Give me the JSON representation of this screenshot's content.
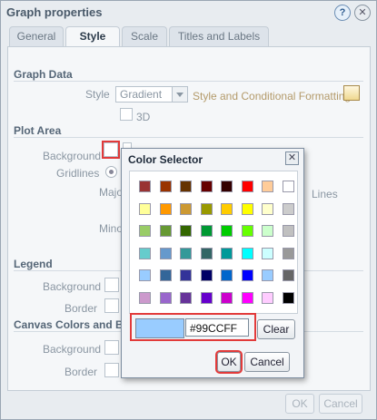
{
  "dialog": {
    "title": "Graph properties",
    "help_icon": "help-icon",
    "close_icon": "close-icon",
    "tabs": [
      {
        "label": "General",
        "active": false
      },
      {
        "label": "Style",
        "active": true
      },
      {
        "label": "Scale",
        "active": false
      },
      {
        "label": "Titles and Labels",
        "active": false
      }
    ],
    "graph_data": {
      "section": "Graph Data",
      "style_label": "Style",
      "style_value": "Gradient",
      "style_link": "Style and Conditional Formatting",
      "threed_label": "3D"
    },
    "plot_area": {
      "section": "Plot Area",
      "background_label": "Background",
      "gridlines_label": "Gridlines",
      "major_label": "Majo",
      "lines_label": "Lines",
      "minor_label": "Mino"
    },
    "legend": {
      "section": "Legend",
      "background_label": "Background",
      "border_label": "Border"
    },
    "canvas": {
      "section": "Canvas Colors and Bo",
      "background_label": "Background",
      "border_label": "Border"
    },
    "footer": {
      "ok": "OK",
      "cancel": "Cancel"
    }
  },
  "color_selector": {
    "title": "Color Selector",
    "hex_value": "#99CCFF",
    "clear_label": "Clear",
    "ok_label": "OK",
    "cancel_label": "Cancel",
    "swatches": [
      [
        "#993333",
        "#993300",
        "#663300",
        "#660000",
        "#330000",
        "#ff0000",
        "#ffcc99",
        "#ffffff"
      ],
      [
        "#ffff99",
        "#ff9900",
        "#cc9933",
        "#999900",
        "#ffcc00",
        "#ffff00",
        "#ffffcc",
        "#cccccc"
      ],
      [
        "#99cc66",
        "#669933",
        "#336600",
        "#009933",
        "#00cc00",
        "#66ff00",
        "#ccffcc",
        "#c0c0c0"
      ],
      [
        "#66cccc",
        "#6699cc",
        "#339999",
        "#336666",
        "#009999",
        "#00ffff",
        "#ccffff",
        "#999999"
      ],
      [
        "#99ccff",
        "#336699",
        "#333399",
        "#000066",
        "#0066cc",
        "#0000ff",
        "#99ccff",
        "#666666"
      ],
      [
        "#cc99cc",
        "#9966cc",
        "#663399",
        "#6600cc",
        "#cc00cc",
        "#ff00ff",
        "#ffccff",
        "#000000"
      ]
    ]
  }
}
